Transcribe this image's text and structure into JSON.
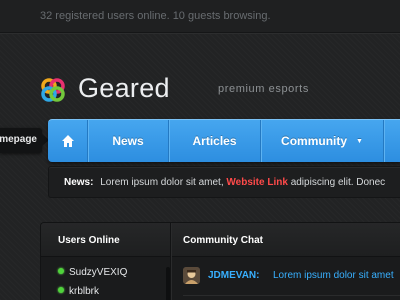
{
  "topbar": {
    "status_text": "32 registered users online. 10 guests browsing."
  },
  "brand": {
    "name": "Geared",
    "tagline": "premium esports",
    "icon": "geared-logo-icon"
  },
  "homepage_tab": {
    "label": "Homepage"
  },
  "nav": {
    "home_icon": "home-icon",
    "items": [
      {
        "label": "News"
      },
      {
        "label": "Articles"
      },
      {
        "label": "Community",
        "icon": "caret-down-icon"
      }
    ]
  },
  "newsbar": {
    "label": "News:",
    "text_before": "Lorem ipsum dolor sit amet,",
    "link": "Website Link",
    "text_after": "adipiscing elit. Donec"
  },
  "users_online": {
    "title": "Users Online",
    "users": [
      {
        "name": "SudzyVEXIQ"
      },
      {
        "name": "krblbrk"
      }
    ]
  },
  "community_chat": {
    "title": "Community Chat",
    "messages": [
      {
        "user": "JDMEVAN:",
        "text": "Lorem ipsum dolor sit amet"
      }
    ]
  },
  "colors": {
    "nav_blue": "#3a9bea",
    "link_red": "#ff4a4a",
    "chat_blue": "#38b0ff",
    "online_green": "#4fd33b"
  }
}
